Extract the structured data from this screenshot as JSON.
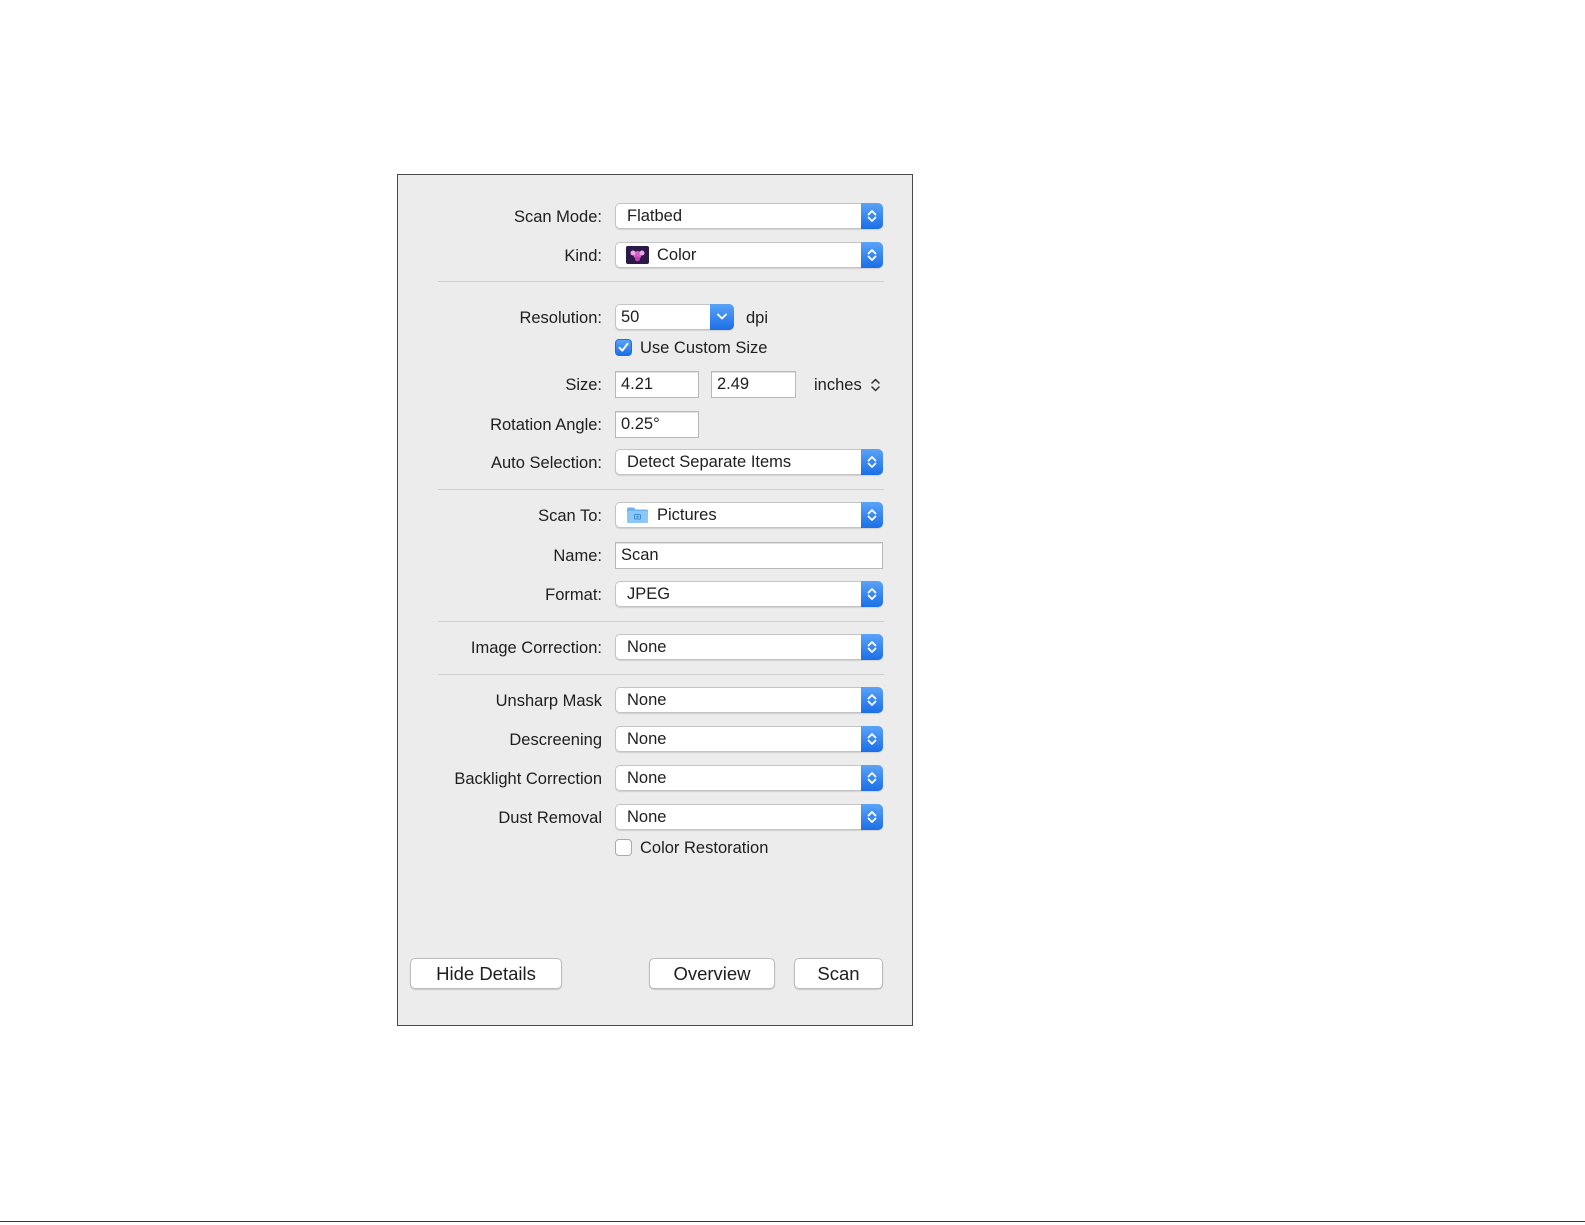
{
  "scan_mode": {
    "label": "Scan Mode:",
    "value": "Flatbed"
  },
  "kind": {
    "label": "Kind:",
    "value": "Color",
    "icon": "color-photo-icon"
  },
  "resolution": {
    "label": "Resolution:",
    "value": "50",
    "unit": "dpi"
  },
  "custom_size": {
    "label": "Use Custom Size",
    "checked": true
  },
  "size": {
    "label": "Size:",
    "width": "4.21",
    "height": "2.49",
    "unit": "inches"
  },
  "rotation": {
    "label": "Rotation Angle:",
    "value": "0.25°"
  },
  "auto_selection": {
    "label": "Auto Selection:",
    "value": "Detect Separate Items"
  },
  "scan_to": {
    "label": "Scan To:",
    "value": "Pictures",
    "icon": "folder-icon"
  },
  "name": {
    "label": "Name:",
    "value": "Scan"
  },
  "format": {
    "label": "Format:",
    "value": "JPEG"
  },
  "image_correction": {
    "label": "Image Correction:",
    "value": "None"
  },
  "unsharp_mask": {
    "label": "Unsharp Mask",
    "value": "None"
  },
  "descreening": {
    "label": "Descreening",
    "value": "None"
  },
  "backlight_correction": {
    "label": "Backlight Correction",
    "value": "None"
  },
  "dust_removal": {
    "label": "Dust Removal",
    "value": "None"
  },
  "color_restoration": {
    "label": "Color Restoration",
    "checked": false
  },
  "buttons": {
    "hide_details": "Hide Details",
    "overview": "Overview",
    "scan": "Scan"
  },
  "colors": {
    "accent": "#1b6fe6",
    "panel_bg": "#ececec",
    "border": "#4a4a4a"
  }
}
